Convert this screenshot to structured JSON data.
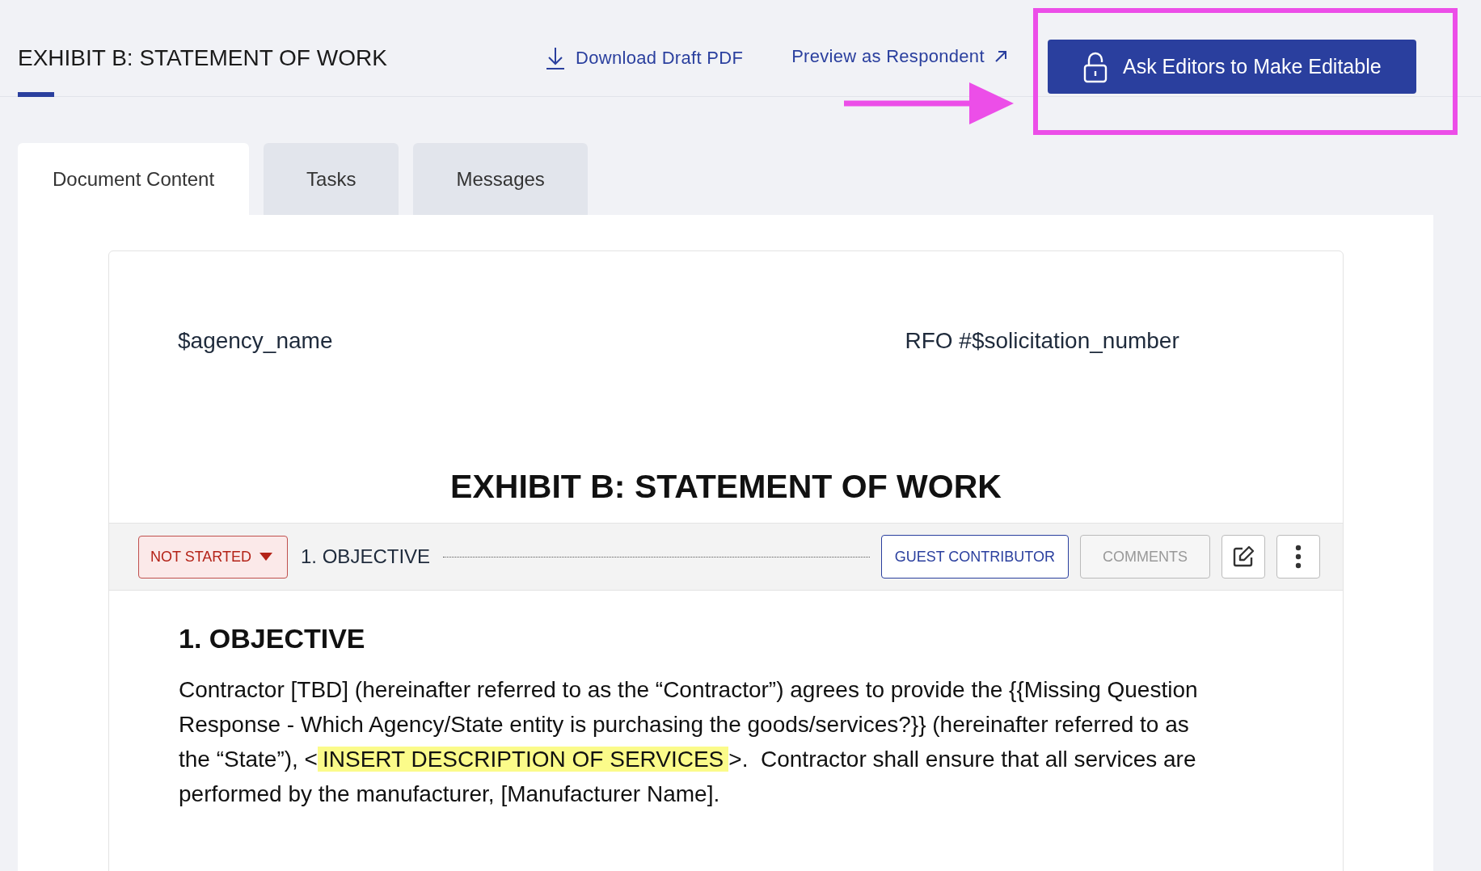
{
  "header": {
    "title": "EXHIBIT B: STATEMENT OF WORK",
    "download_link": "Download Draft PDF",
    "preview_link": "Preview as Respondent",
    "primary_button": "Ask Editors to Make Editable"
  },
  "annotation": {
    "highlight_box": true,
    "arrow": true
  },
  "tabs": [
    {
      "label": "Document Content",
      "selected": true
    },
    {
      "label": "Tasks",
      "selected": false
    },
    {
      "label": "Messages",
      "selected": false
    }
  ],
  "document": {
    "header_left": "$agency_name",
    "header_right": "RFO #$solicitation_number",
    "title": "EXHIBIT B: STATEMENT OF WORK",
    "section_bar": {
      "status": "NOT STARTED",
      "section_name": "1. OBJECTIVE",
      "guest_button": "GUEST CONTRIBUTOR",
      "comments_button": "COMMENTS",
      "comments_disabled": true
    },
    "section_heading": "1. OBJECTIVE",
    "paragraph": {
      "before": "Contractor [TBD] (hereinafter referred to as the “Contractor”) agrees to provide the {{Missing Question Response - Which Agency/State entity is purchasing the goods/services?}} (hereinafter referred to as the “State”), <",
      "highlight": "INSERT DESCRIPTION OF SERVICES",
      "after": ">.  Contractor shall ensure that all services are performed by the manufacturer, [Manufacturer Name]."
    }
  }
}
